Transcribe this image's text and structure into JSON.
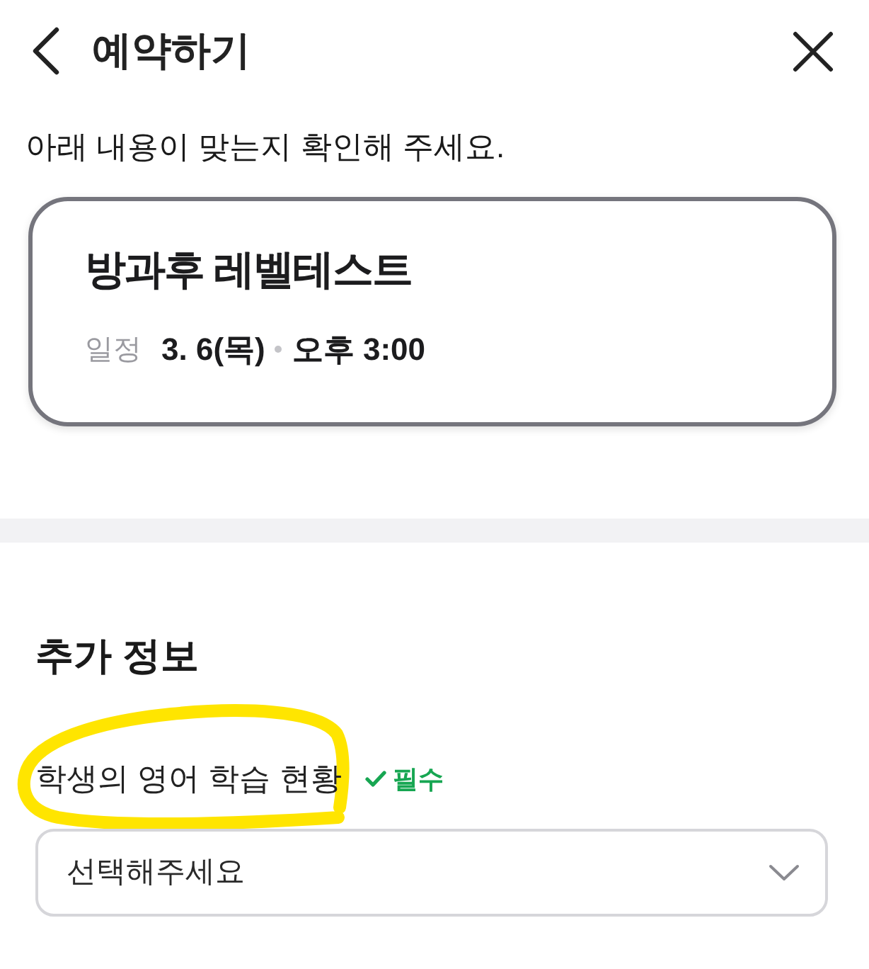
{
  "header": {
    "title": "예약하기"
  },
  "instruction": "아래 내용이 맞는지 확인해 주세요.",
  "booking_card": {
    "title": "방과후 레벨테스트",
    "schedule_label": "일정",
    "date": "3. 6(목)",
    "time": "오후 3:00"
  },
  "additional_info": {
    "heading": "추가 정보",
    "fields": [
      {
        "kind": "select",
        "label": "학생의 영어 학습 현황",
        "highlighted": true,
        "required": true,
        "required_label": "필수",
        "placeholder": "선택해주세요"
      }
    ]
  }
}
